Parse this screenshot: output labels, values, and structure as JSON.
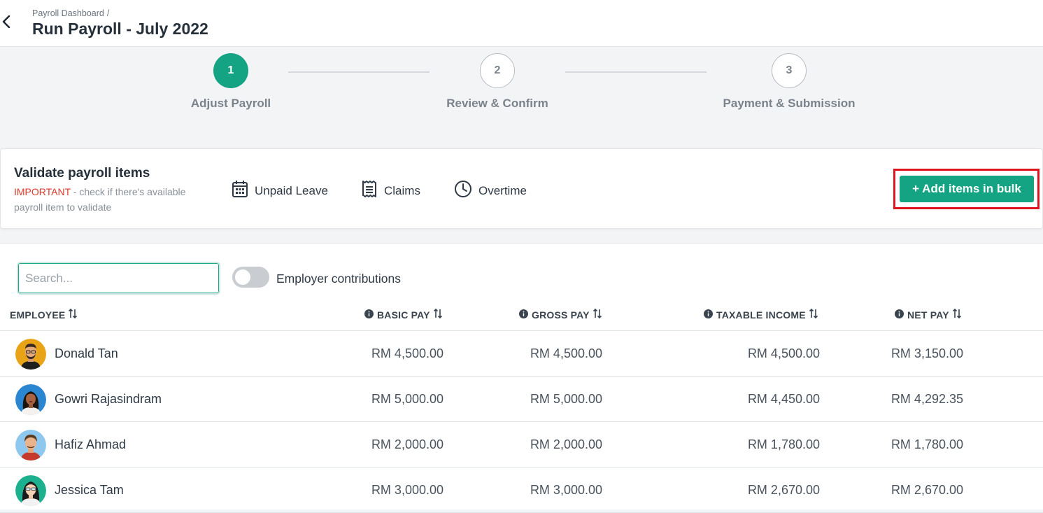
{
  "header": {
    "breadcrumb": "Payroll Dashboard",
    "breadcrumb_sep": "/",
    "title": "Run Payroll - July 2022"
  },
  "stepper": {
    "steps": [
      {
        "number": "1",
        "label": "Adjust Payroll",
        "active": true
      },
      {
        "number": "2",
        "label": "Review & Confirm",
        "active": false
      },
      {
        "number": "3",
        "label": "Payment & Submission",
        "active": false
      }
    ]
  },
  "validate": {
    "title": "Validate payroll items",
    "important": "IMPORTANT",
    "note": " - check if there's available payroll item to validate",
    "links": [
      {
        "label": "Unpaid Leave",
        "icon": "calendar-icon"
      },
      {
        "label": "Claims",
        "icon": "receipt-icon"
      },
      {
        "label": "Overtime",
        "icon": "clock-icon"
      }
    ],
    "bulk_button": "+ Add items in bulk"
  },
  "table": {
    "search_placeholder": "Search...",
    "toggle_label": "Employer contributions",
    "columns": {
      "employee": "EMPLOYEE",
      "basic_pay": "BASIC PAY",
      "gross_pay": "GROSS PAY",
      "taxable_income": "TAXABLE INCOME",
      "net_pay": "NET PAY"
    },
    "rows": [
      {
        "name": "Donald Tan",
        "basic_pay": "RM 4,500.00",
        "gross_pay": "RM 4,500.00",
        "taxable_income": "RM 4,500.00",
        "net_pay": "RM 3,150.00"
      },
      {
        "name": "Gowri Rajasindram",
        "basic_pay": "RM 5,000.00",
        "gross_pay": "RM 5,000.00",
        "taxable_income": "RM 4,450.00",
        "net_pay": "RM 4,292.35"
      },
      {
        "name": "Hafiz Ahmad",
        "basic_pay": "RM 2,000.00",
        "gross_pay": "RM 2,000.00",
        "taxable_income": "RM 1,780.00",
        "net_pay": "RM 1,780.00"
      },
      {
        "name": "Jessica Tam",
        "basic_pay": "RM 3,000.00",
        "gross_pay": "RM 3,000.00",
        "taxable_income": "RM 2,670.00",
        "net_pay": "RM 2,670.00"
      }
    ]
  },
  "colors": {
    "accent": "#14a383",
    "important": "#e0392b",
    "highlight": "#e0141e"
  }
}
